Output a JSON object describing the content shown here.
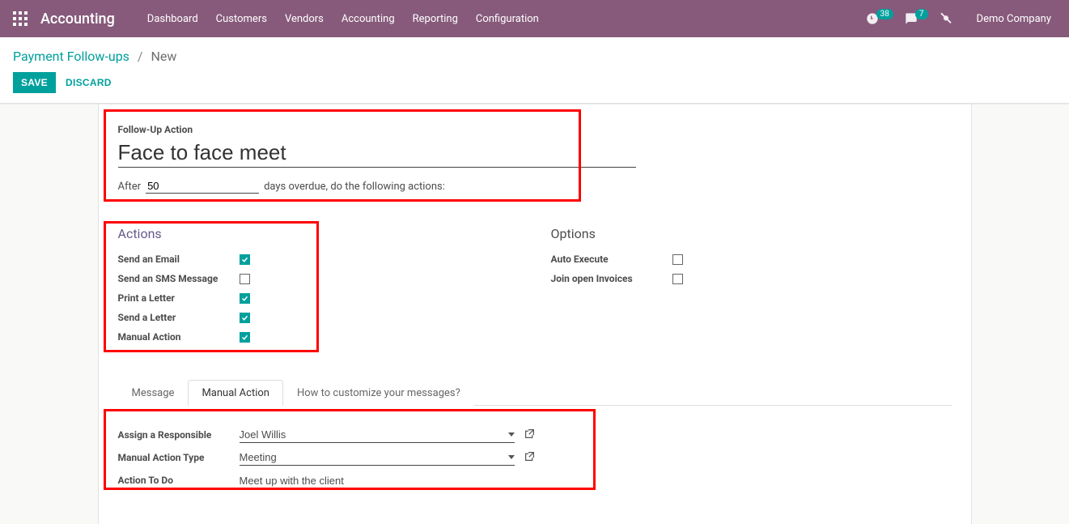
{
  "nav": {
    "brand": "Accounting",
    "menu": [
      "Dashboard",
      "Customers",
      "Vendors",
      "Accounting",
      "Reporting",
      "Configuration"
    ],
    "timer_badge": "38",
    "chat_badge": "7",
    "company": "Demo Company"
  },
  "breadcrumb": {
    "parent": "Payment Follow-ups",
    "current": "New"
  },
  "buttons": {
    "save": "Save",
    "discard": "Discard"
  },
  "form": {
    "title_label": "Follow-Up Action",
    "title_value": "Face to face meet",
    "after_label": "After",
    "delay_value": "50",
    "after_suffix": "days overdue, do the following actions:",
    "actions_title": "Actions",
    "options_title": "Options",
    "actions": [
      {
        "label": "Send an Email",
        "checked": true
      },
      {
        "label": "Send an SMS Message",
        "checked": false
      },
      {
        "label": "Print a Letter",
        "checked": true
      },
      {
        "label": "Send a Letter",
        "checked": true
      },
      {
        "label": "Manual Action",
        "checked": true
      }
    ],
    "options": [
      {
        "label": "Auto Execute",
        "checked": false
      },
      {
        "label": "Join open Invoices",
        "checked": false
      }
    ],
    "tabs": [
      "Message",
      "Manual Action",
      "How to customize your messages?"
    ],
    "active_tab": 1,
    "manual": {
      "responsible_label": "Assign a Responsible",
      "responsible_value": "Joel Willis",
      "type_label": "Manual Action Type",
      "type_value": "Meeting",
      "todo_label": "Action To Do",
      "todo_value": "Meet up with the client"
    }
  }
}
